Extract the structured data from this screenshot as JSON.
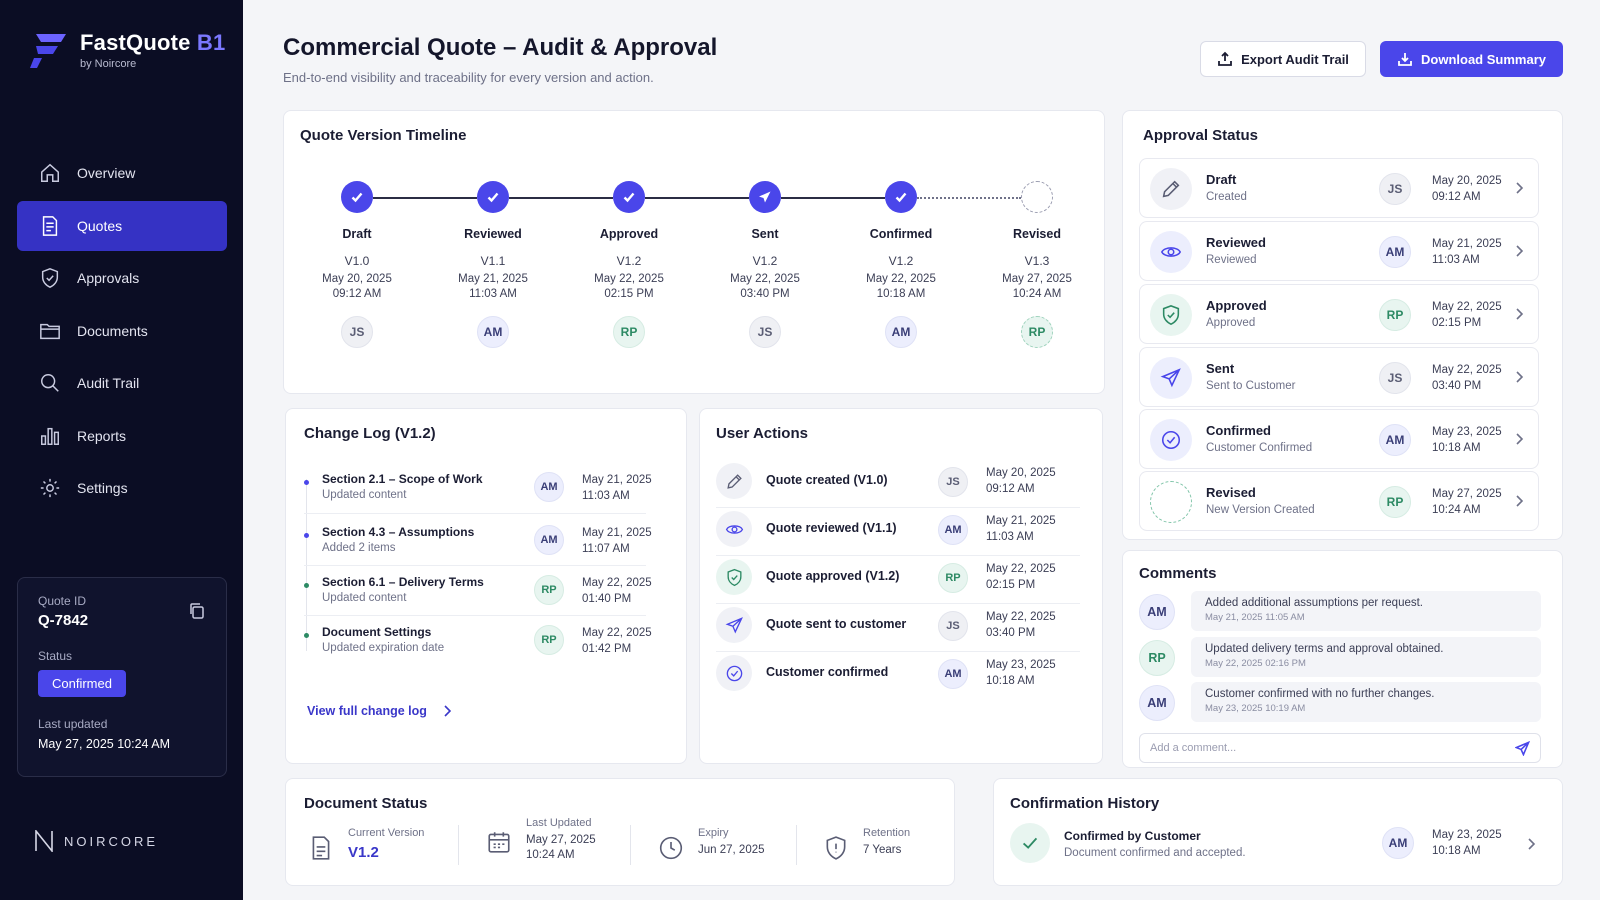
{
  "brand": {
    "name": "FastQuote",
    "suffix": "B1",
    "sub": "by Noircore",
    "footer": "NOIRCORE"
  },
  "nav": [
    {
      "label": "Overview",
      "icon": "home-icon"
    },
    {
      "label": "Quotes",
      "icon": "document-icon",
      "active": true
    },
    {
      "label": "Approvals",
      "icon": "shield-check-icon"
    },
    {
      "label": "Documents",
      "icon": "folder-icon"
    },
    {
      "label": "Audit Trail",
      "icon": "search-icon"
    },
    {
      "label": "Reports",
      "icon": "bar-chart-icon"
    },
    {
      "label": "Settings",
      "icon": "gear-icon"
    }
  ],
  "quote_card": {
    "id_label": "Quote ID",
    "id": "Q-7842",
    "status_label": "Status",
    "status": "Confirmed",
    "updated_label": "Last updated",
    "updated": "May 27, 2025 10:24 AM"
  },
  "header": {
    "title": "Commercial Quote – Audit & Approval",
    "subtitle": "End-to-end visibility and traceability for every version and action.",
    "export_label": "Export Audit Trail",
    "download_label": "Download Summary"
  },
  "colors": {
    "accent": "#4a46ea",
    "sidebar": "#0b0d24",
    "success": "#2d8a64"
  },
  "timeline": {
    "title": "Quote Version Timeline",
    "steps": [
      {
        "label": "Draft",
        "version": "V1.0",
        "date": "May 20, 2025",
        "time": "09:12 AM",
        "user": "JS",
        "state": "done"
      },
      {
        "label": "Reviewed",
        "version": "V1.1",
        "date": "May 21, 2025",
        "time": "11:03 AM",
        "user": "AM",
        "state": "done"
      },
      {
        "label": "Approved",
        "version": "V1.2",
        "date": "May 22, 2025",
        "time": "02:15 PM",
        "user": "RP",
        "state": "done"
      },
      {
        "label": "Sent",
        "version": "V1.2",
        "date": "May 22, 2025",
        "time": "03:40 PM",
        "user": "JS",
        "state": "sent"
      },
      {
        "label": "Confirmed",
        "version": "V1.2",
        "date": "May 22, 2025",
        "time": "10:18 AM",
        "user": "AM",
        "state": "done"
      },
      {
        "label": "Revised",
        "version": "V1.3",
        "date": "May 27, 2025",
        "time": "10:24 AM",
        "user": "RP",
        "state": "pending"
      }
    ]
  },
  "approval": {
    "title": "Approval Status",
    "items": [
      {
        "title": "Draft",
        "sub": "Created",
        "user": "JS",
        "date": "May 20, 2025",
        "time": "09:12 AM",
        "icon": "pencil-icon"
      },
      {
        "title": "Reviewed",
        "sub": "Reviewed",
        "user": "AM",
        "date": "May 21, 2025",
        "time": "11:03 AM",
        "icon": "eye-icon"
      },
      {
        "title": "Approved",
        "sub": "Approved",
        "user": "RP",
        "date": "May 22, 2025",
        "time": "02:15 PM",
        "icon": "shield-check-icon"
      },
      {
        "title": "Sent",
        "sub": "Sent to Customer",
        "user": "JS",
        "date": "May 22, 2025",
        "time": "03:40 PM",
        "icon": "send-icon"
      },
      {
        "title": "Confirmed",
        "sub": "Customer Confirmed",
        "user": "AM",
        "date": "May 23, 2025",
        "time": "10:18 AM",
        "icon": "check-circle-icon"
      },
      {
        "title": "Revised",
        "sub": "New Version Created",
        "user": "RP",
        "date": "May 27, 2025",
        "time": "10:24 AM",
        "icon": "dashed-circle-icon"
      }
    ]
  },
  "changelog": {
    "title": "Change Log (V1.2)",
    "items": [
      {
        "title": "Section 2.1 – Scope of Work",
        "sub": "Updated content",
        "user": "AM",
        "date": "May 21, 2025",
        "time": "11:03 AM"
      },
      {
        "title": "Section 4.3 – Assumptions",
        "sub": "Added 2 items",
        "user": "AM",
        "date": "May 21, 2025",
        "time": "11:07 AM"
      },
      {
        "title": "Section 6.1 – Delivery Terms",
        "sub": "Updated content",
        "user": "RP",
        "date": "May 22, 2025",
        "time": "01:40 PM"
      },
      {
        "title": "Document Settings",
        "sub": "Updated expiration date",
        "user": "RP",
        "date": "May 22, 2025",
        "time": "01:42 PM"
      }
    ],
    "link": "View full change log"
  },
  "user_actions": {
    "title": "User Actions",
    "items": [
      {
        "text": "Quote created (V1.0)",
        "user": "JS",
        "date": "May 20, 2025",
        "time": "09:12 AM",
        "icon": "pencil-icon"
      },
      {
        "text": "Quote reviewed (V1.1)",
        "user": "AM",
        "date": "May 21, 2025",
        "time": "11:03 AM",
        "icon": "eye-icon"
      },
      {
        "text": "Quote approved (V1.2)",
        "user": "RP",
        "date": "May 22, 2025",
        "time": "02:15 PM",
        "icon": "shield-check-icon"
      },
      {
        "text": "Quote sent to customer",
        "user": "JS",
        "date": "May 22, 2025",
        "time": "03:40 PM",
        "icon": "send-icon"
      },
      {
        "text": "Customer confirmed",
        "user": "AM",
        "date": "May 23, 2025",
        "time": "10:18 AM",
        "icon": "check-circle-icon"
      }
    ]
  },
  "comments": {
    "title": "Comments",
    "items": [
      {
        "user": "AM",
        "text": "Added additional assumptions per request.",
        "date": "May 21, 2025 11:05 AM"
      },
      {
        "user": "RP",
        "text": "Updated delivery terms and approval obtained.",
        "date": "May 22, 2025 02:16 PM"
      },
      {
        "user": "AM",
        "text": "Customer confirmed with no further changes.",
        "date": "May 23, 2025 10:19 AM"
      }
    ],
    "placeholder": "Add a comment..."
  },
  "document_status": {
    "title": "Document Status",
    "current_label": "Current Version",
    "current": "V1.2",
    "updated_label": "Last Updated",
    "updated_date": "May 27, 2025",
    "updated_time": "10:24 AM",
    "expiry_label": "Expiry",
    "expiry": "Jun 27, 2025",
    "retention_label": "Retention",
    "retention": "7 Years"
  },
  "confirmation": {
    "title": "Confirmation History",
    "item_title": "Confirmed by Customer",
    "item_sub": "Document confirmed and accepted.",
    "user": "AM",
    "date": "May 23, 2025",
    "time": "10:18 AM"
  }
}
